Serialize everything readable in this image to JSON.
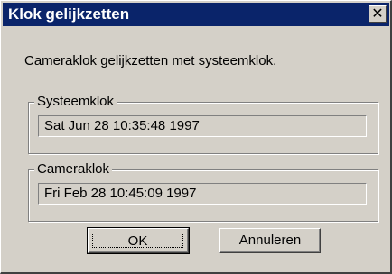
{
  "window": {
    "title": "Klok gelijkzetten",
    "close_glyph": "✕"
  },
  "message": "Cameraklok gelijkzetten met systeemklok.",
  "system_clock": {
    "label": "Systeemklok",
    "value": "Sat Jun 28 10:35:48 1997"
  },
  "camera_clock": {
    "label": "Cameraklok",
    "value": "Fri Feb 28 10:45:09 1997"
  },
  "buttons": {
    "ok": "OK",
    "cancel": "Annuleren"
  },
  "colors": {
    "titlebar": "#0a246a",
    "face": "#d4d0c8"
  }
}
